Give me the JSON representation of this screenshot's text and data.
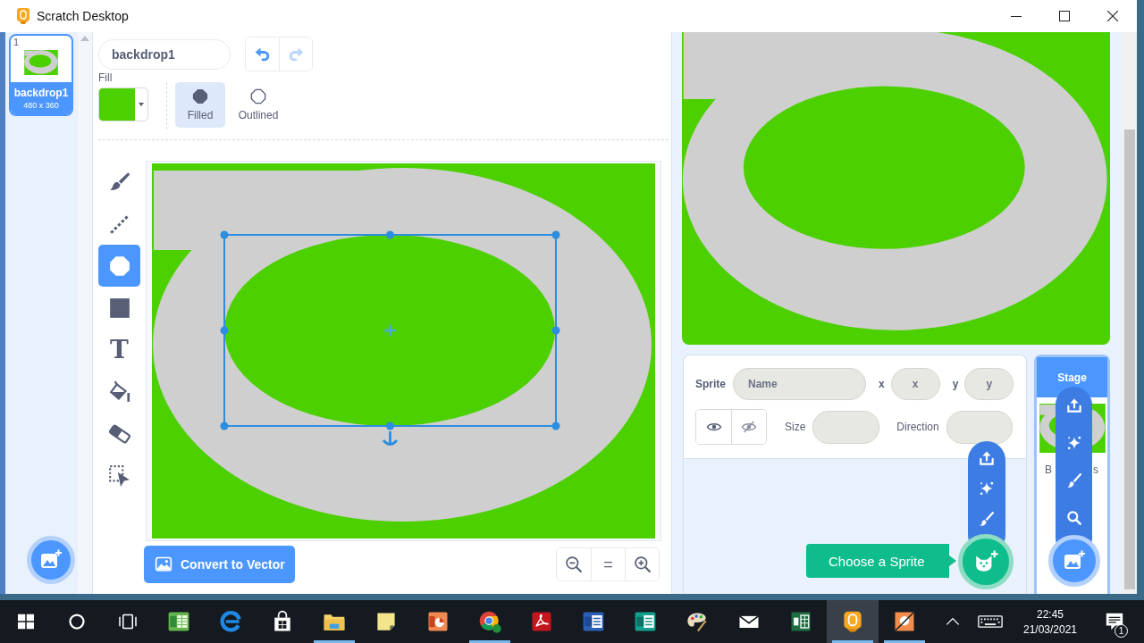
{
  "window": {
    "title": "Scratch Desktop"
  },
  "costumes": [
    {
      "number": "1",
      "name": "backdrop1",
      "size": "480 x 360",
      "selected": true
    }
  ],
  "paint_editor": {
    "costume_name": "backdrop1",
    "history": [
      {
        "kind": "undo",
        "disabled": false
      },
      {
        "kind": "redo",
        "disabled": true
      }
    ],
    "fill": {
      "label": "Fill",
      "color": "#4cd000"
    },
    "modes": [
      {
        "kind": "filled",
        "label": "Filled",
        "selected": true
      },
      {
        "kind": "outlined",
        "label": "Outlined",
        "selected": false
      }
    ],
    "tools": [
      {
        "kind": "brush",
        "selected": false
      },
      {
        "kind": "line",
        "selected": false
      },
      {
        "kind": "circle",
        "selected": true
      },
      {
        "kind": "rectangle",
        "selected": false
      },
      {
        "kind": "text",
        "glyph": "T",
        "selected": false
      },
      {
        "kind": "fill",
        "selected": false
      },
      {
        "kind": "eraser",
        "selected": false
      },
      {
        "kind": "select",
        "selected": false
      }
    ],
    "convert_button": "Convert to Vector",
    "zoom": [
      {
        "kind": "zoom_out"
      },
      {
        "kind": "reset",
        "glyph": "="
      },
      {
        "kind": "zoom_in"
      }
    ]
  },
  "sprite_info": {
    "label": "Sprite",
    "name": {
      "placeholder": "Name"
    },
    "x": {
      "label": "x",
      "placeholder": "x"
    },
    "y": {
      "label": "y",
      "placeholder": "y"
    },
    "visibility": [
      {
        "kind": "show",
        "selected": false
      },
      {
        "kind": "hide",
        "selected": false
      }
    ],
    "size": {
      "label": "Size"
    },
    "direction": {
      "label": "Direction"
    }
  },
  "sprite_menu": {
    "items": [
      {
        "kind": "upload"
      },
      {
        "kind": "surprise"
      },
      {
        "kind": "paint"
      }
    ],
    "tooltip": "Choose a Sprite"
  },
  "stage_pane": {
    "header": "Stage",
    "selected": true,
    "label_fragments": [
      "B",
      "s"
    ],
    "menu_items": [
      {
        "kind": "upload"
      },
      {
        "kind": "surprise"
      },
      {
        "kind": "paint"
      },
      {
        "kind": "search"
      }
    ]
  },
  "taskbar": {
    "system": [
      {
        "kind": "start"
      },
      {
        "kind": "search"
      },
      {
        "kind": "task_view"
      }
    ],
    "apps": [
      {
        "kind": "spreadsheet",
        "open": false,
        "selected": false
      },
      {
        "kind": "browser_e",
        "open": false,
        "selected": false
      },
      {
        "kind": "store",
        "open": false,
        "selected": false
      },
      {
        "kind": "folder",
        "open": true,
        "selected": false
      },
      {
        "kind": "sticky_note",
        "open": false,
        "selected": false
      },
      {
        "kind": "presentation",
        "open": false,
        "selected": false
      },
      {
        "kind": "browser_c",
        "open": true,
        "selected": false
      },
      {
        "kind": "pdf",
        "open": false,
        "selected": false
      },
      {
        "kind": "document",
        "open": false,
        "selected": false
      },
      {
        "kind": "publisher",
        "open": false,
        "selected": false
      },
      {
        "kind": "paint",
        "open": false,
        "selected": false
      },
      {
        "kind": "mail",
        "open": false,
        "selected": false
      },
      {
        "kind": "spreadsheet2",
        "open": false,
        "selected": false
      },
      {
        "kind": "scratch",
        "open": true,
        "selected": true
      },
      {
        "kind": "app",
        "open": true,
        "selected": false
      }
    ],
    "tray": [
      {
        "kind": "chevron"
      },
      {
        "kind": "keyboard"
      }
    ],
    "clock": {
      "time": "22:45",
      "date": "21/03/2021"
    },
    "notification_count": "1"
  }
}
